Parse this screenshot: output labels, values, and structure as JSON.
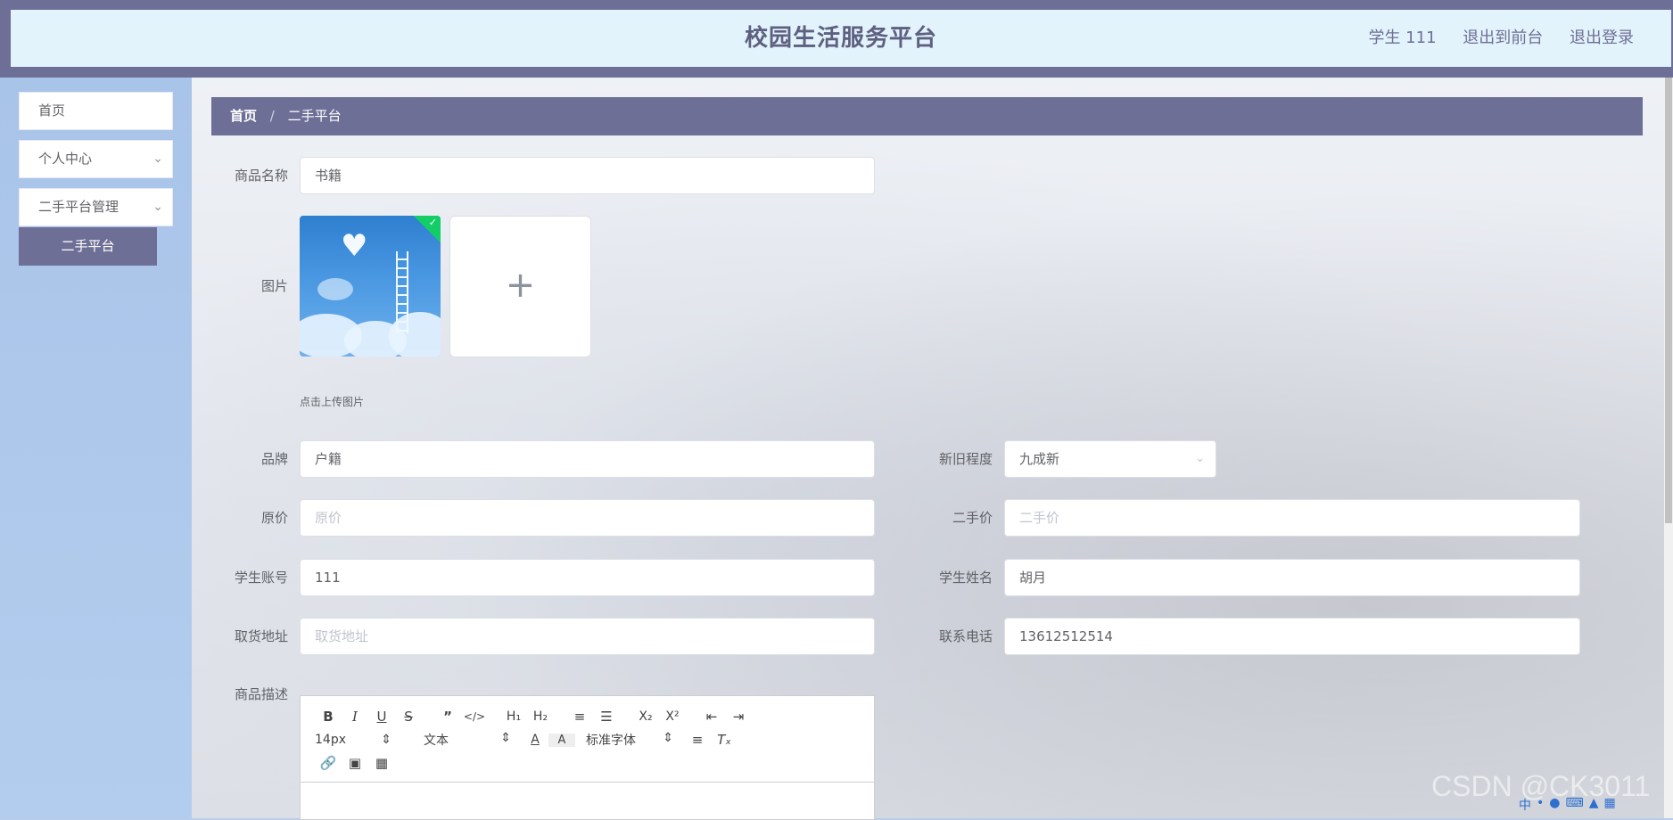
{
  "header": {
    "title": "校园生活服务平台",
    "user": "学生 111",
    "back_front": "退出到前台",
    "logout": "退出登录"
  },
  "sidebar": {
    "home": "首页",
    "personal": "个人中心",
    "secondhand_mgmt": "二手平台管理",
    "secondhand": "二手平台"
  },
  "breadcrumb": {
    "home": "首页",
    "sep": "/",
    "current": "二手平台"
  },
  "form": {
    "name_label": "商品名称",
    "name_value": "书籍",
    "image_label": "图片",
    "upload_tip": "点击上传图片",
    "brand_label": "品牌",
    "brand_value": "户籍",
    "condition_label": "新旧程度",
    "condition_value": "九成新",
    "orig_price_label": "原价",
    "orig_price_placeholder": "原价",
    "second_price_label": "二手价",
    "second_price_placeholder": "二手价",
    "account_label": "学生账号",
    "account_value": "111",
    "student_name_label": "学生姓名",
    "student_name_value": "胡月",
    "address_label": "取货地址",
    "address_placeholder": "取货地址",
    "phone_label": "联系电话",
    "phone_value": "13612512514",
    "desc_label": "商品描述"
  },
  "editor": {
    "font_size": "14px",
    "block_type": "文本",
    "font_family": "标准字体"
  },
  "watermark": "CSDN @CK3011",
  "icons": [
    "chevron-down-icon",
    "plus-icon",
    "check-icon",
    "bold-icon",
    "italic-icon",
    "underline-icon",
    "strike-icon",
    "quote-icon",
    "code-icon",
    "h1-icon",
    "h2-icon",
    "ordered-list-icon",
    "bullet-list-icon",
    "subscript-icon",
    "superscript-icon",
    "outdent-icon",
    "indent-icon",
    "font-color-icon",
    "background-color-icon",
    "align-icon",
    "clear-format-icon",
    "link-icon",
    "image-icon",
    "video-icon"
  ]
}
